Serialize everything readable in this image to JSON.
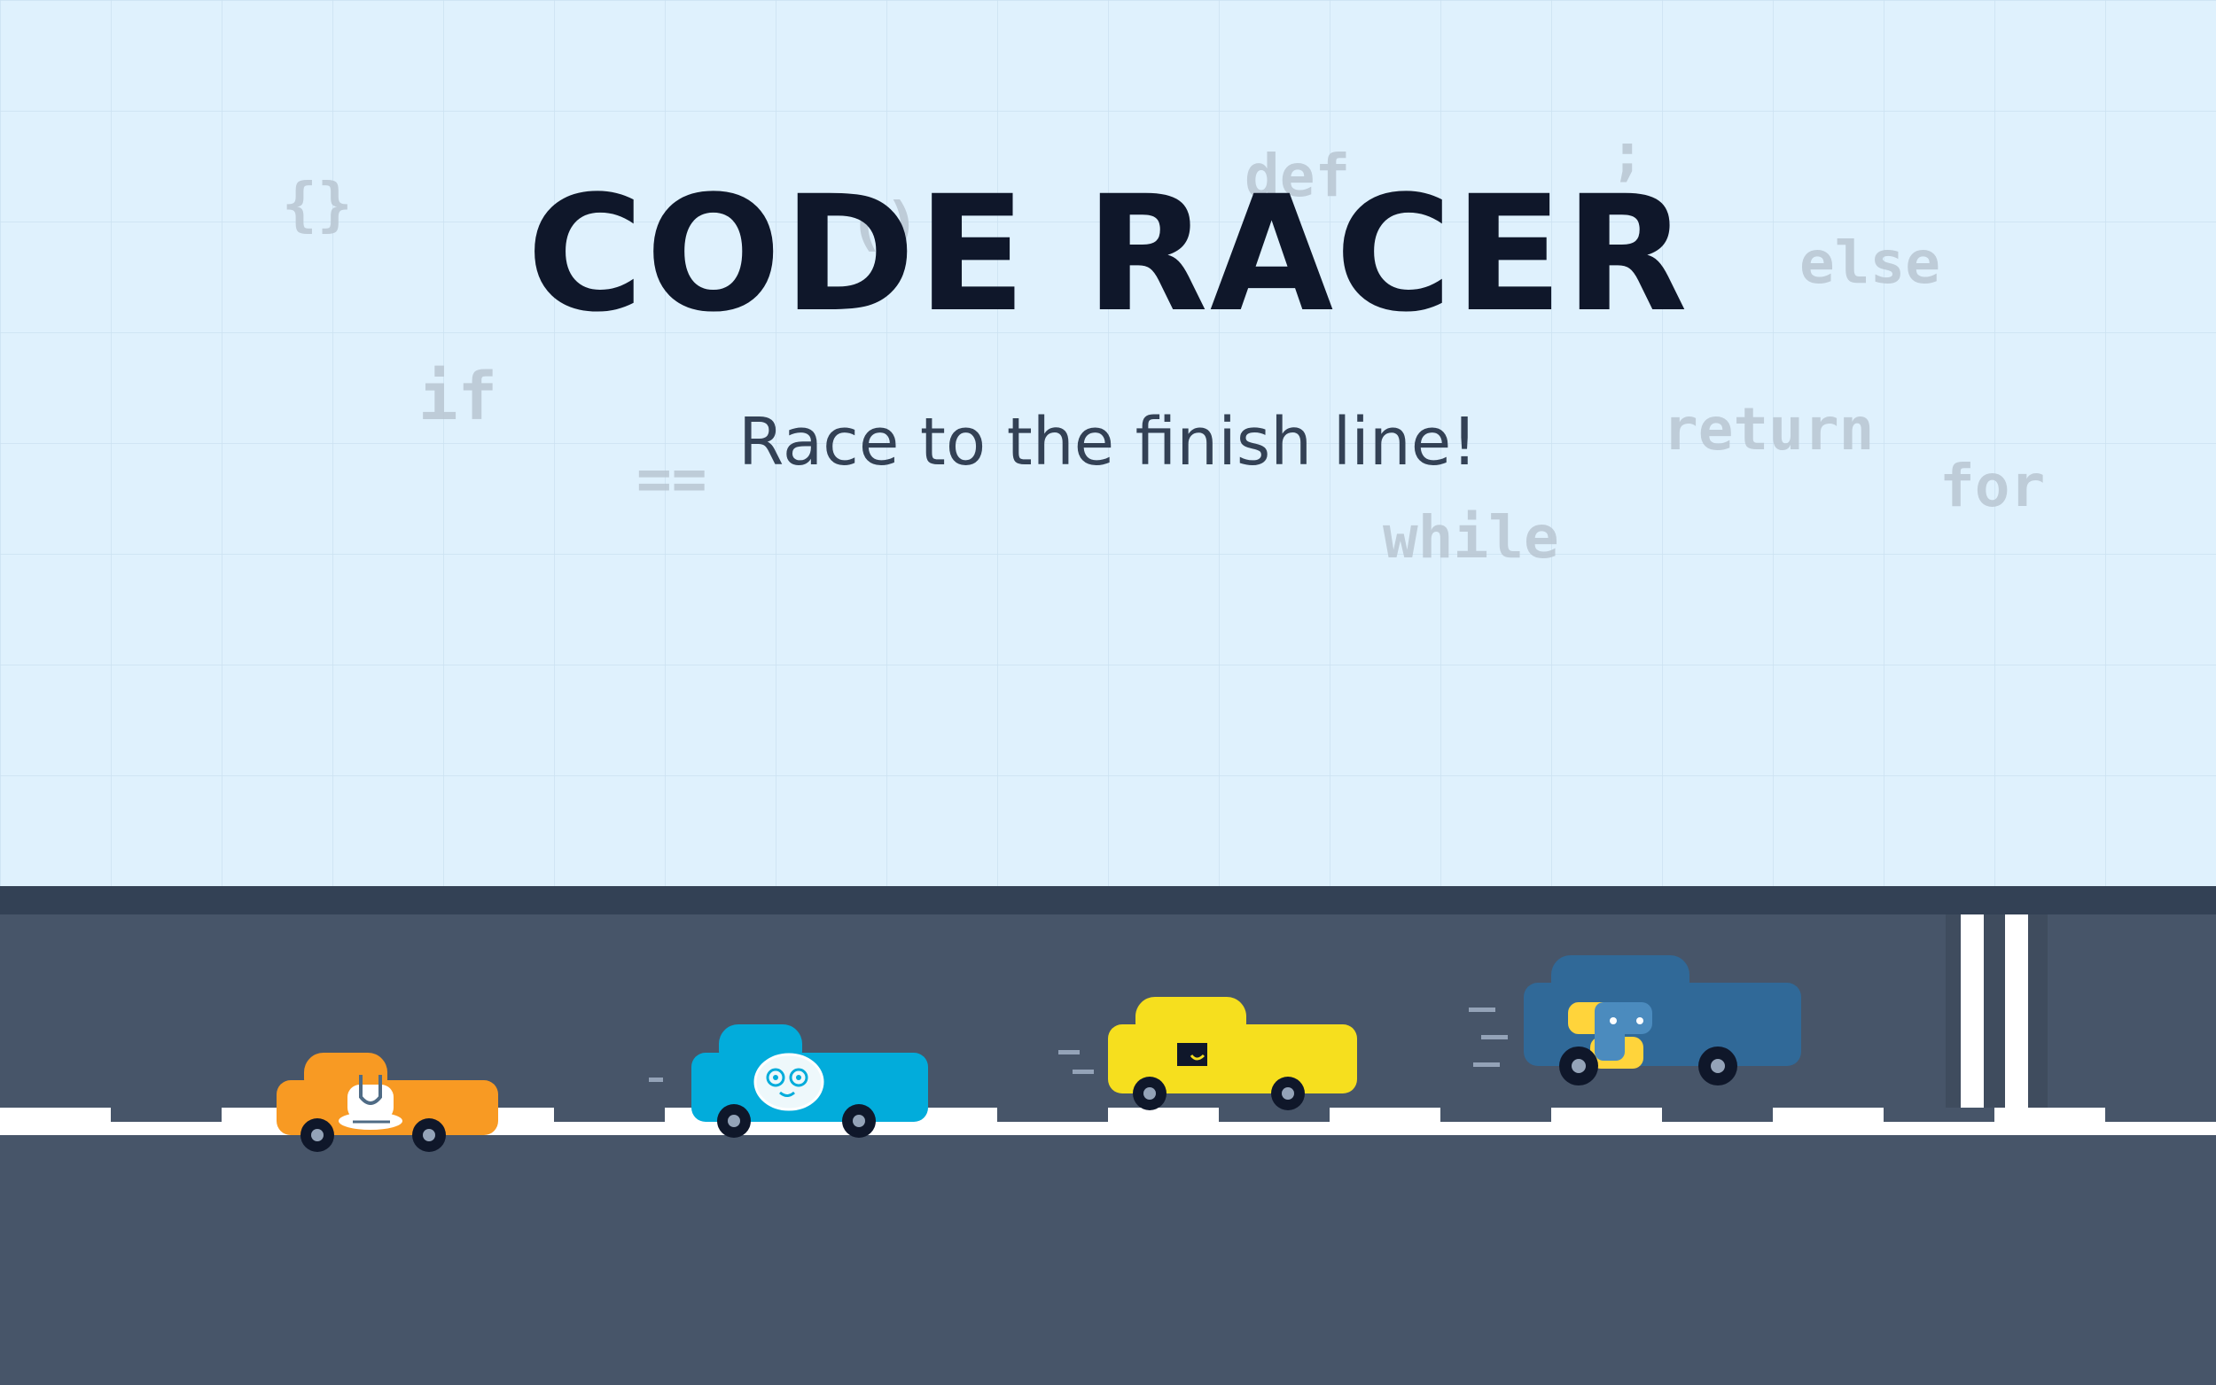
{
  "game": {
    "title": "CODE RACER",
    "subtitle": "Race to the finish line!"
  },
  "background_keywords": [
    "{}",
    "()",
    "def",
    ";",
    "else",
    "if",
    "==",
    "return",
    "for",
    "while"
  ],
  "colors": {
    "sky": "#dff1fd",
    "grid": "#cbe1f1",
    "road": "#475569",
    "road_edge": "#334155",
    "lane_line": "#ffffff",
    "title": "#0f172a",
    "subtitle": "#334155",
    "keyword": "#b9c6d2"
  },
  "racers": [
    {
      "id": "orange-racer",
      "color": "#f89a23",
      "logo": "cpp-logo-icon"
    },
    {
      "id": "cyan-racer",
      "color": "#02acdb",
      "logo": "go-gopher-icon"
    },
    {
      "id": "yellow-racer",
      "color": "#f6df1e",
      "logo": "javascript-logo-icon"
    },
    {
      "id": "blue-racer",
      "color": "#306998",
      "logo": "python-logo-icon"
    }
  ]
}
